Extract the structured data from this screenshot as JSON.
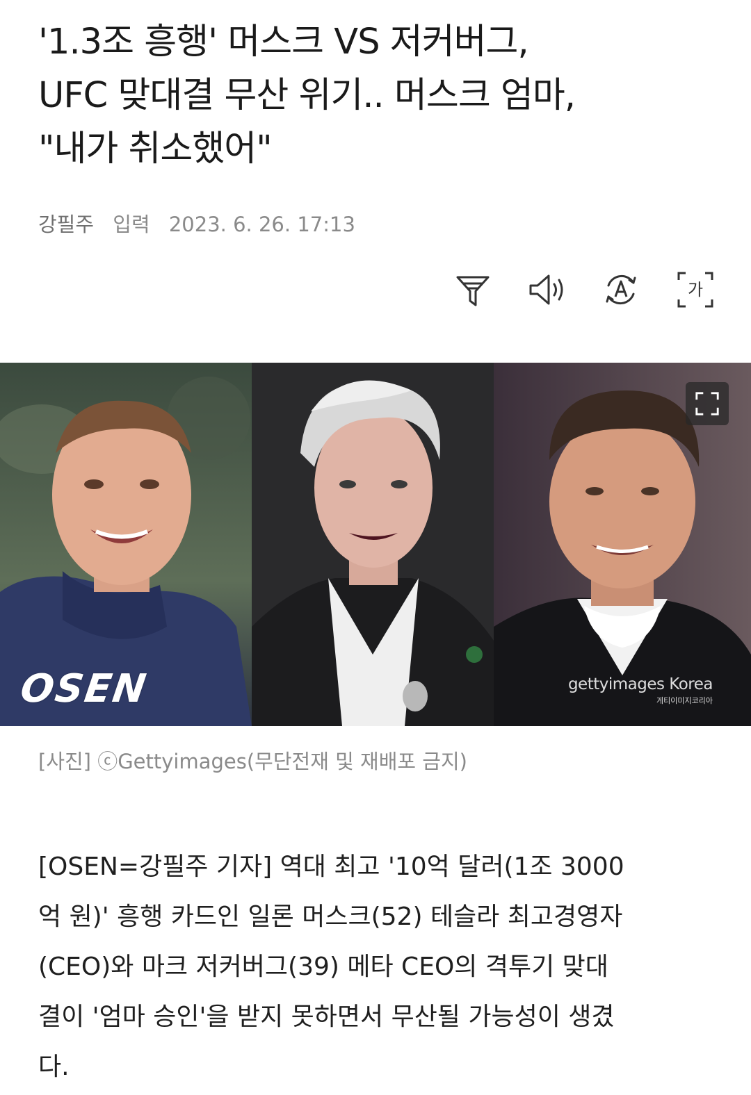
{
  "article": {
    "headline_lines": [
      "'1.3조 흥행' 머스크 VS 저커버그,",
      "UFC 맞대결 무산 위기.. 머스크 엄마,",
      "\"내가 취소했어\""
    ],
    "author": "강필주",
    "date_label": "입력",
    "date": "2023. 6. 26. 17:13",
    "toolbar": {
      "items": [
        {
          "name": "summary",
          "icon": "filter-funnel-icon"
        },
        {
          "name": "listen",
          "icon": "speaker-icon"
        },
        {
          "name": "translate",
          "icon": "translate-a-icon"
        },
        {
          "name": "font-size",
          "icon": "font-size-ga-icon",
          "glyph": "가"
        }
      ]
    },
    "photo": {
      "watermark_osen": "OSEN",
      "watermark_getty": "gettyimages Korea",
      "watermark_getty_sub": "게티이미지코리아",
      "expand_icon": "expand-icon"
    },
    "caption": "[사진] ⓒGettyimages(무단전재 및 재배포 금지)",
    "body_lines": [
      "[OSEN=강필주 기자] 역대 최고 '10억 달러(1조 3000",
      "억 원)' 흥행 카드인 일론 머스크(52) 테슬라 최고경영자",
      "(CEO)와 마크 저커버그(39) 메타 CEO의 격투기 맞대",
      "결이 '엄마 승인'을 받지 못하면서 무산될 가능성이 생겼",
      "다."
    ]
  },
  "colors": {
    "text": "#1a1a1a",
    "meta": "#8a8a8a",
    "icon": "#333333"
  }
}
